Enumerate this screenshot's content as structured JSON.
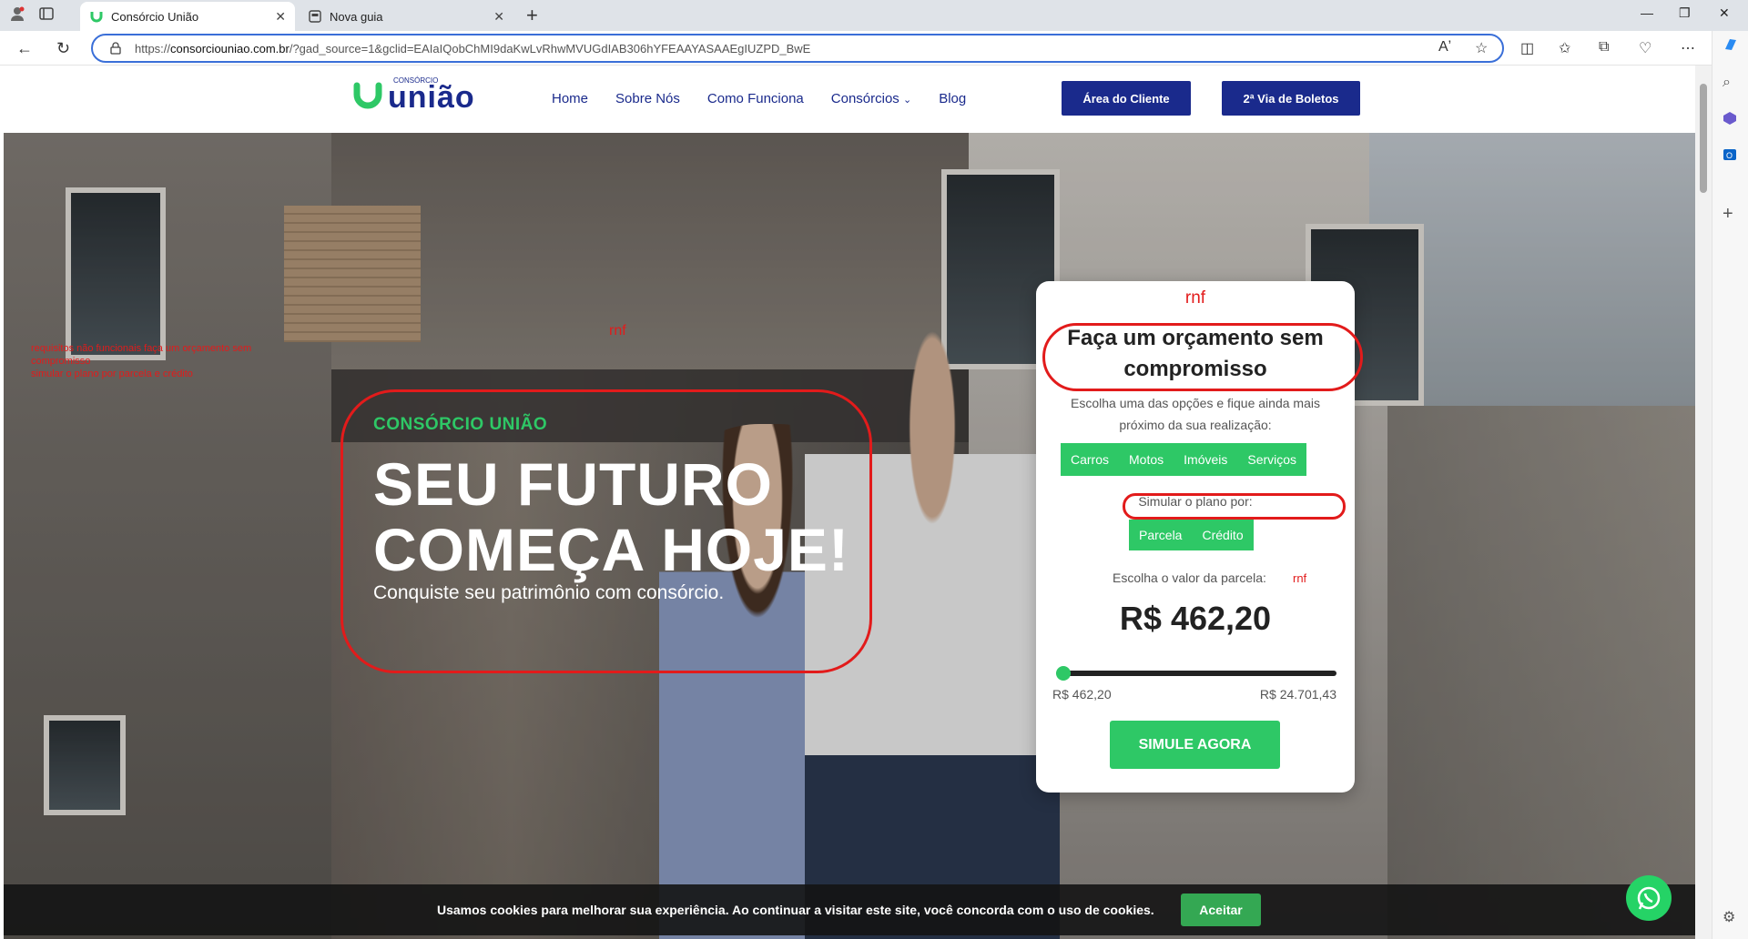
{
  "browser": {
    "tabs": [
      {
        "title": "Consórcio União"
      },
      {
        "title": "Nova guia"
      }
    ],
    "url_prefix": "https://",
    "url_domain": "consorciouniao.com.br",
    "url_rest": "/?gad_source=1&gclid=EAIaIQobChMI9daKwLvRhwMVUGdIAB306hYFEAAYASAAEgIUZPD_BwE"
  },
  "header": {
    "logo_small": "CONSÓRCIO",
    "logo_word": "união",
    "nav": [
      "Home",
      "Sobre Nós",
      "Como Funciona",
      "Consórcios",
      "Blog"
    ],
    "area_cliente": "Área do Cliente",
    "segunda_via": "2ª Via de Boletos"
  },
  "annotations": {
    "small_note_line1": "requisitos não funcionais faça um orçamento sem compromisso",
    "small_note_line2": "simular o plano por parcela e crédito",
    "rnf_hero": "rnf",
    "rnf_card_top": "rnf",
    "rnf_value": "rnf"
  },
  "hero": {
    "kicker": "CONSÓRCIO UNIÃO",
    "title_line1": "SEU FUTURO",
    "title_line2": "COMEÇA HOJE!",
    "subtitle": "Conquiste seu patrimônio com consórcio."
  },
  "card": {
    "title": "Faça um orçamento sem compromisso",
    "description": "Escolha uma das opções e fique ainda mais próximo da sua realização:",
    "categories": [
      "Carros",
      "Motos",
      "Imóveis",
      "Serviços"
    ],
    "simulate_by_label": "Simular o plano por:",
    "simulate_by_options": [
      "Parcela",
      "Crédito"
    ],
    "value_label": "Escolha o valor da parcela:",
    "value": "R$ 462,20",
    "slider_level": 0.0,
    "min_label": "R$ 462,20",
    "max_label": "R$ 24.701,43",
    "button": "SIMULE AGORA"
  },
  "cookie": {
    "message": "Usamos cookies para melhorar sua experiência. Ao continuar a visitar este site, você concorda com o uso de cookies.",
    "accept": "Aceitar"
  },
  "colors": {
    "green": "#2ec866",
    "navy": "#1a2a8c",
    "annotation_red": "#e21b1b"
  }
}
